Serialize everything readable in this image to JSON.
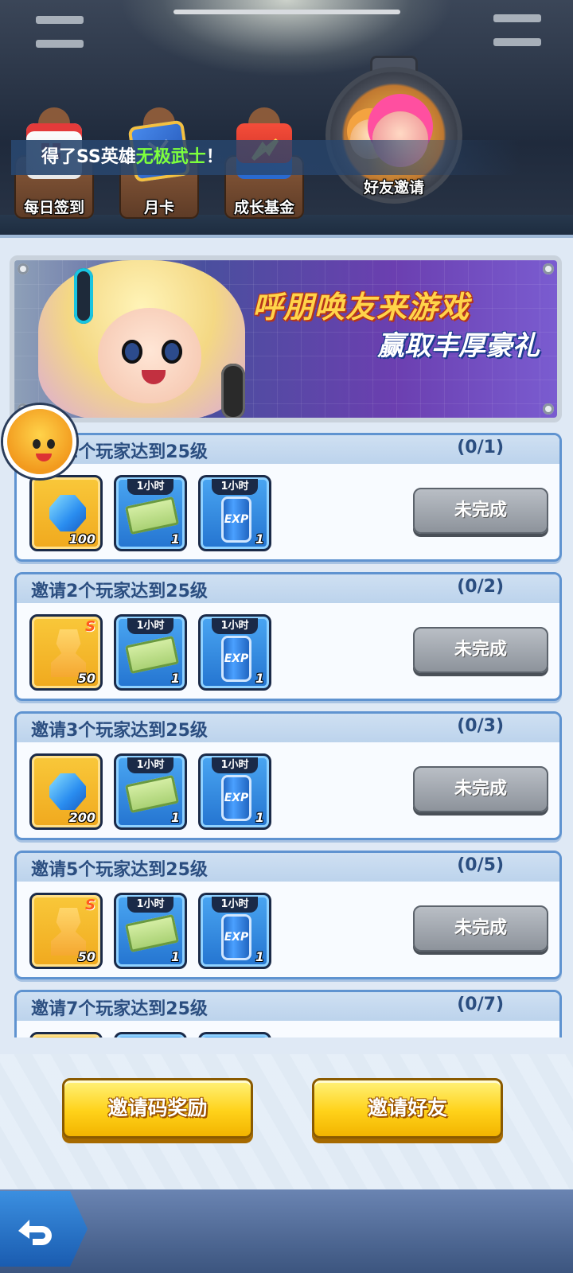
{
  "ticker": {
    "prefix": "得了SS英雄",
    "highlight": "无极武士",
    "suffix": "！"
  },
  "top_tabs": [
    {
      "label": "每日签到",
      "icon": "calendar-icon"
    },
    {
      "label": "月卡",
      "icon": "card-icon"
    },
    {
      "label": "成长基金",
      "icon": "chest-icon"
    },
    {
      "label": "好友邀请",
      "icon": "friends-icon",
      "active": true
    }
  ],
  "banner": {
    "line1": "呼朋唤友来游戏",
    "line2": "赢取丰厚豪礼"
  },
  "quests": [
    {
      "title": "邀请1个玩家达到25级",
      "progress": "(0/1)",
      "rewards": [
        {
          "type": "gem",
          "count": "100"
        },
        {
          "type": "money",
          "time": "1小时",
          "count": "1"
        },
        {
          "type": "exp",
          "time": "1小时",
          "count": "1"
        }
      ],
      "status": "未完成"
    },
    {
      "title": "邀请2个玩家达到25级",
      "progress": "(0/2)",
      "rewards": [
        {
          "type": "hero-shard",
          "grade": "S",
          "count": "50"
        },
        {
          "type": "money",
          "time": "1小时",
          "count": "1"
        },
        {
          "type": "exp",
          "time": "1小时",
          "count": "1"
        }
      ],
      "status": "未完成"
    },
    {
      "title": "邀请3个玩家达到25级",
      "progress": "(0/3)",
      "rewards": [
        {
          "type": "gem",
          "count": "200"
        },
        {
          "type": "money",
          "time": "1小时",
          "count": "1"
        },
        {
          "type": "exp",
          "time": "1小时",
          "count": "1"
        }
      ],
      "status": "未完成"
    },
    {
      "title": "邀请5个玩家达到25级",
      "progress": "(0/5)",
      "rewards": [
        {
          "type": "hero-shard",
          "grade": "S",
          "count": "50"
        },
        {
          "type": "money",
          "time": "1小时",
          "count": "1"
        },
        {
          "type": "exp",
          "time": "1小时",
          "count": "1"
        }
      ],
      "status": "未完成"
    },
    {
      "title": "邀请7个玩家达到25级",
      "progress": "(0/7)",
      "rewards": [],
      "status": ""
    }
  ],
  "exp_label": "EXP",
  "buttons": {
    "invite_code_reward": "邀请码奖励",
    "invite_friend": "邀请好友"
  },
  "colors": {
    "panel_bg": "#dfe9f5",
    "card_border": "#5f93d0",
    "title_text": "#2b4e80",
    "highlight_green": "#7dff3d",
    "button_yellow": "#ffd21a"
  }
}
